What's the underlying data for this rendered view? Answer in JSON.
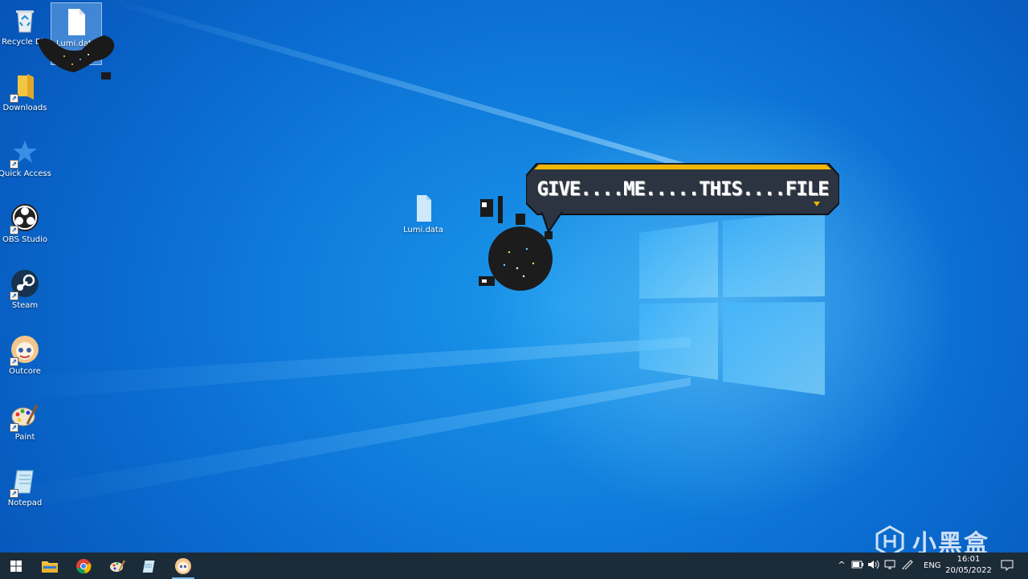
{
  "desktop": {
    "icons": [
      {
        "label": "Recycle Bin",
        "icon": "recycle-bin-icon"
      },
      {
        "label": "Lumi.data",
        "icon": "file-icon",
        "selected": true
      },
      {
        "label": "Downloads",
        "icon": "folder-icon"
      },
      {
        "label": "Quick Access",
        "icon": "star-icon"
      },
      {
        "label": "OBS Studio",
        "icon": "obs-icon"
      },
      {
        "label": "Steam",
        "icon": "steam-icon"
      },
      {
        "label": "Outcore",
        "icon": "outcore-icon"
      },
      {
        "label": "Paint",
        "icon": "paint-icon"
      },
      {
        "label": "Notepad",
        "icon": "notepad-icon"
      }
    ],
    "center_file": {
      "label": "Lumi.data",
      "icon": "file-icon"
    }
  },
  "speech_bubble": {
    "text": "GIVE....ME.....THIS....FILE"
  },
  "taskbar": {
    "apps": [
      {
        "name": "start-button",
        "icon": "windows-icon"
      },
      {
        "name": "file-explorer",
        "icon": "folder-icon"
      },
      {
        "name": "chrome",
        "icon": "chrome-icon"
      },
      {
        "name": "paint",
        "icon": "paint-icon"
      },
      {
        "name": "notepad",
        "icon": "notepad-icon"
      },
      {
        "name": "outcore",
        "icon": "outcore-icon",
        "active": true
      }
    ],
    "tray": {
      "language": "ENG",
      "time": "16:01",
      "date": "20/05/2022"
    }
  },
  "watermark": {
    "text": "小黑盒"
  },
  "colors": {
    "desktop_blue": "#0b6fd3",
    "taskbar": "#1c2b38",
    "bubble_accent": "#f2b705"
  }
}
